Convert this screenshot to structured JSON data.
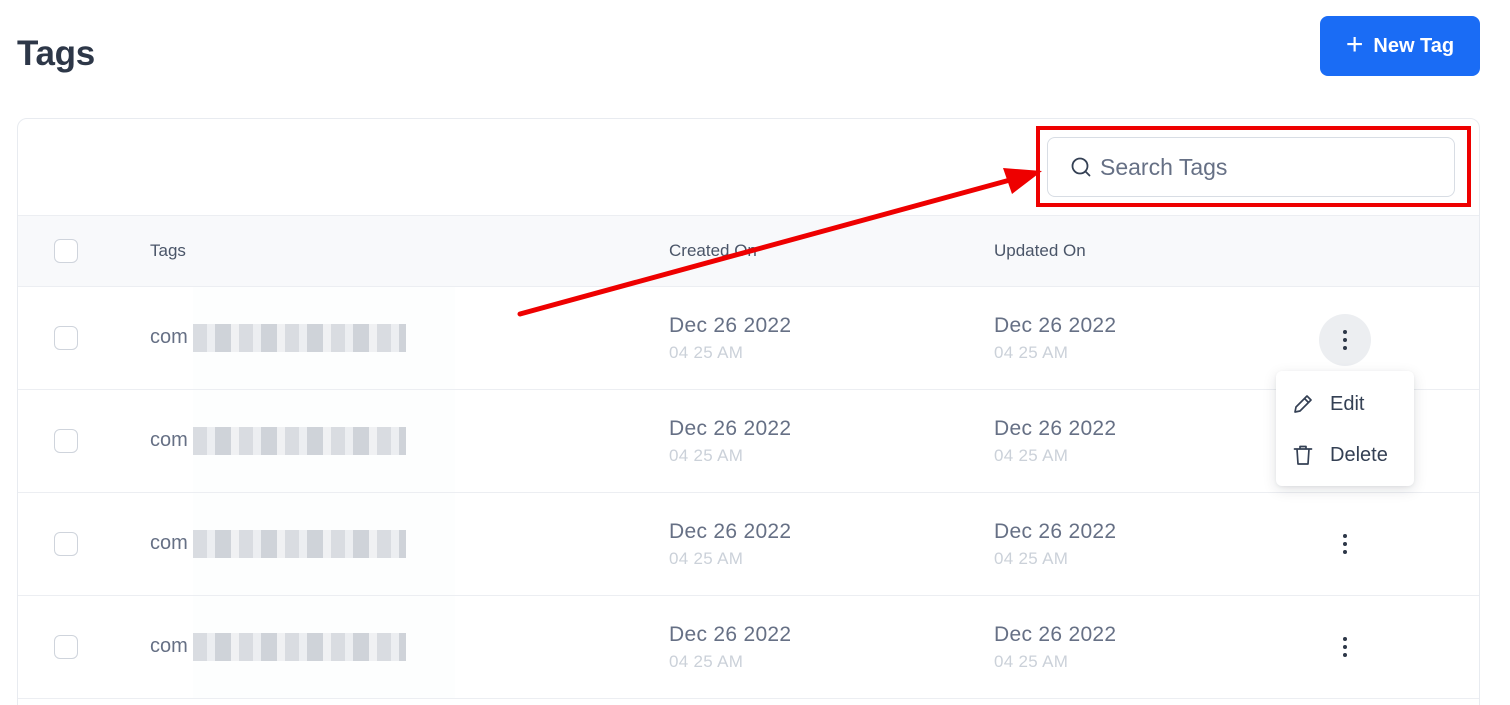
{
  "page": {
    "title": "Tags"
  },
  "toolbar": {
    "new_tag_label": "New Tag"
  },
  "search": {
    "placeholder": "Search Tags",
    "value": ""
  },
  "table": {
    "columns": [
      "Tags",
      "Created On",
      "Updated On"
    ],
    "rows": [
      {
        "tag_prefix": "com",
        "created_date": "Dec 26 2022",
        "created_time": "04 25 AM",
        "updated_date": "Dec 26 2022",
        "updated_time": "04 25 AM"
      },
      {
        "tag_prefix": "com",
        "created_date": "Dec 26 2022",
        "created_time": "04 25 AM",
        "updated_date": "Dec 26 2022",
        "updated_time": "04 25 AM"
      },
      {
        "tag_prefix": "com",
        "created_date": "Dec 26 2022",
        "created_time": "04 25 AM",
        "updated_date": "Dec 26 2022",
        "updated_time": "04 25 AM"
      },
      {
        "tag_prefix": "com",
        "created_date": "Dec 26 2022",
        "created_time": "04 25 AM",
        "updated_date": "Dec 26 2022",
        "updated_time": "04 25 AM"
      }
    ]
  },
  "row_menu": {
    "items": [
      {
        "label": "Edit",
        "icon": "pencil-icon"
      },
      {
        "label": "Delete",
        "icon": "trash-icon"
      }
    ]
  },
  "colors": {
    "primary": "#1a6cf5",
    "annotation": "#ee0000"
  }
}
